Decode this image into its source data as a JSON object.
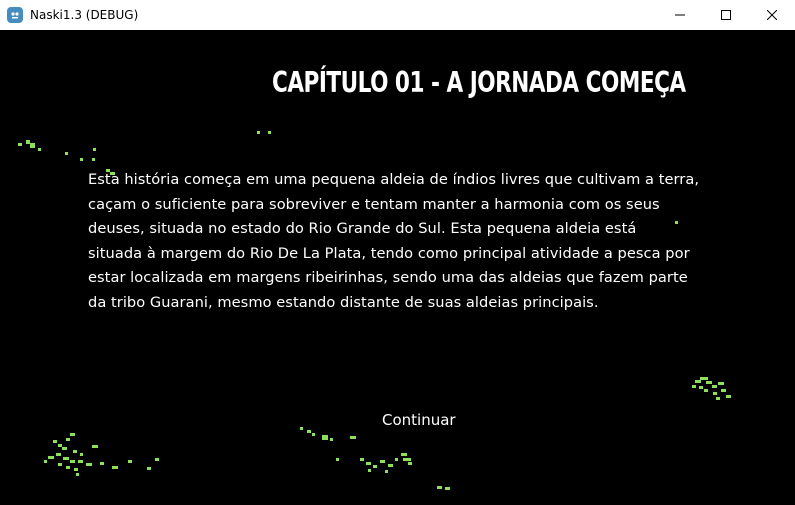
{
  "window": {
    "title": "Naski1.3 (DEBUG)",
    "controls": {
      "minimize": "minimize-icon",
      "maximize": "maximize-icon",
      "close": "close-icon"
    }
  },
  "game": {
    "chapter_title": "CAPÍTULO 01 - A JORNADA COMEÇA",
    "story_lines": [
      "Esta história começa em uma pequena aldeia de índios livres que cultivam a terra,",
      "caçam o suficiente para sobreviver e tentam manter a harmonia com os seus",
      "deuses, situada no estado do Rio Grande do Sul. Esta pequena aldeia está",
      "situada à margem do Rio De La Plata, tendo como principal atividade a pesca por",
      "estar localizada em margens ribeirinhas, sendo uma das aldeias que fazem parte",
      "da tribo Guarani, mesmo estando distante de suas aldeias principais."
    ],
    "continue_label": "Continuar"
  },
  "colors": {
    "background": "#000000",
    "text": "#ffffff",
    "particles": "#8ee05a",
    "titlebar": "#ffffff"
  }
}
